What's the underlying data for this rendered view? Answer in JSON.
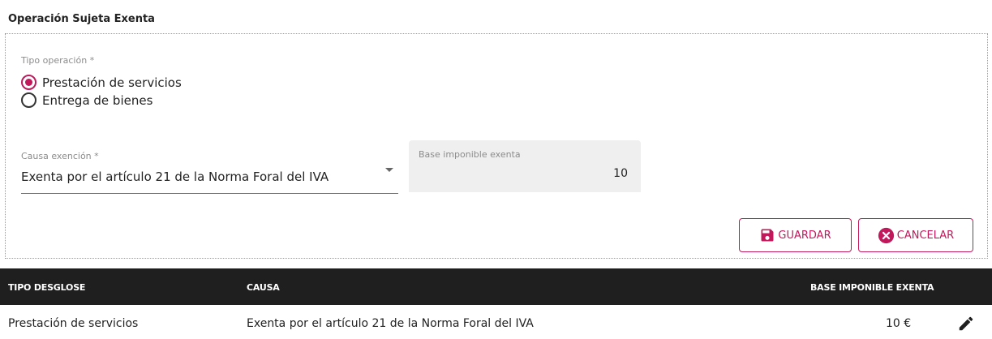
{
  "section": {
    "title": "Operación Sujeta Exenta"
  },
  "form": {
    "tipo_operacion": {
      "label": "Tipo operación *",
      "options": [
        {
          "label": "Prestación de servicios",
          "selected": true
        },
        {
          "label": "Entrega de bienes",
          "selected": false
        }
      ]
    },
    "causa_exencion": {
      "label": "Causa exención *",
      "value": "Exenta por el artículo 21 de la Norma Foral del IVA"
    },
    "base_imponible": {
      "label": "Base imponible exenta",
      "value": "10"
    }
  },
  "buttons": {
    "save_label": "GUARDAR",
    "cancel_label": "CANCELAR"
  },
  "table": {
    "columns": [
      "TIPO DESGLOSE",
      "CAUSA",
      "BASE IMPONIBLE EXENTA"
    ],
    "rows": [
      {
        "tipo": "Prestación de servicios",
        "causa": "Exenta por el artículo 21 de la Norma Foral del IVA",
        "base": "10 €"
      }
    ]
  },
  "colors": {
    "accent": "#c2185b",
    "header_bg": "#1f1f1f",
    "filled_bg": "#efefef"
  },
  "icons": {
    "save": "floppy-disk-icon",
    "cancel": "x-circle-icon",
    "edit": "pencil-icon",
    "dropdown": "caret-down-icon"
  }
}
